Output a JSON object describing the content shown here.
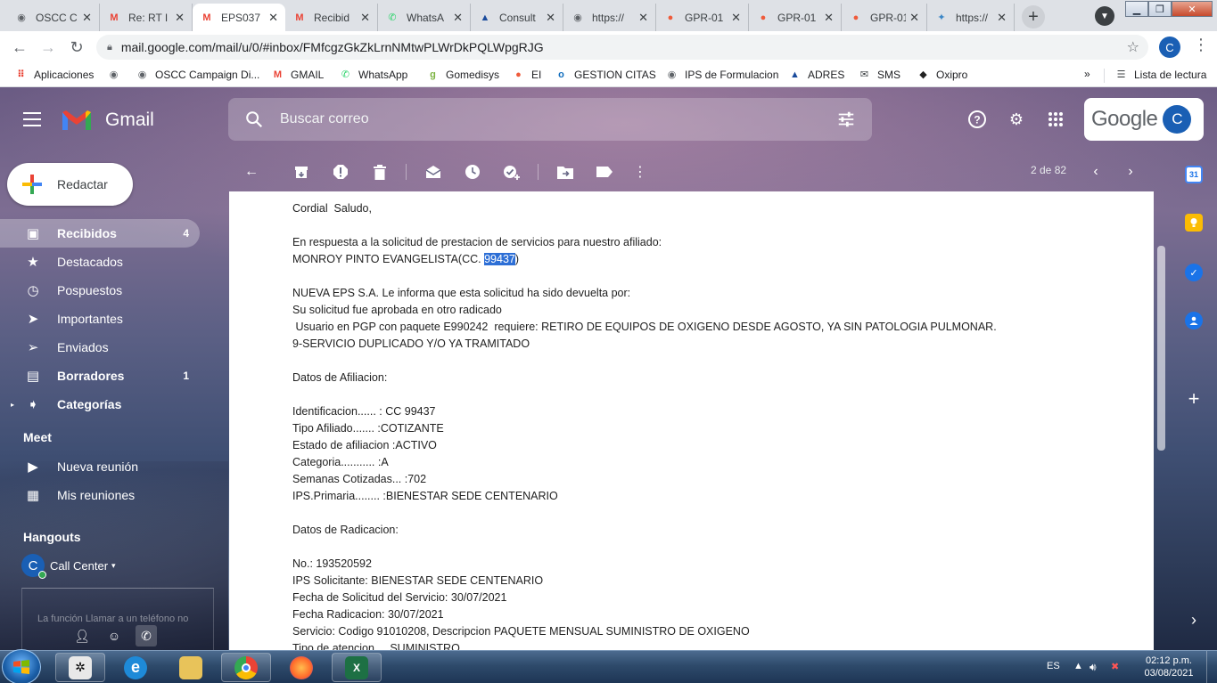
{
  "browser": {
    "tabs": [
      {
        "title": "OSCC C",
        "icon": "globe-icon",
        "color": "#5f6368",
        "active": false
      },
      {
        "title": "Re: RT I",
        "icon": "gmail-icon",
        "color": "#ea4335",
        "active": false
      },
      {
        "title": "EPS037",
        "icon": "gmail-icon",
        "color": "#ea4335",
        "active": true
      },
      {
        "title": "Recibid",
        "icon": "gmail-icon",
        "color": "#ea4335",
        "active": false
      },
      {
        "title": "WhatsA",
        "icon": "whatsapp-icon",
        "color": "#25d366",
        "active": false
      },
      {
        "title": "Consult",
        "icon": "adres-icon",
        "color": "#1a4b9c",
        "active": false
      },
      {
        "title": "https://",
        "icon": "globe-icon",
        "color": "#5f6368",
        "active": false
      },
      {
        "title": "GPR-01",
        "icon": "gpr-icon",
        "color": "#ef5b3b",
        "active": false
      },
      {
        "title": "GPR-01",
        "icon": "gpr-icon",
        "color": "#ef5b3b",
        "active": false
      },
      {
        "title": "GPR-01",
        "icon": "gpr-icon",
        "color": "#ef5b3b",
        "active": false
      },
      {
        "title": "https://",
        "icon": "bird-icon",
        "color": "#3b86c6",
        "active": false
      }
    ],
    "url": "mail.google.com/mail/u/0/#inbox/FMfcgzGkZkLrnNMtwPLWrDkPQLWpgRJG",
    "profile_initial": "C",
    "bookmarks": [
      {
        "label": "Aplicaciones",
        "icon": "apps-grid-icon",
        "color": "#ea4335"
      },
      {
        "label": "",
        "icon": "globe-icon",
        "color": "#5f6368"
      },
      {
        "label": "OSCC Campaign Di...",
        "icon": "globe-icon",
        "color": "#5f6368"
      },
      {
        "label": "GMAIL",
        "icon": "gmail-icon",
        "color": "#ea4335"
      },
      {
        "label": "WhatsApp",
        "icon": "whatsapp-icon",
        "color": "#25d366"
      },
      {
        "label": "Gomedisys",
        "icon": "gomedisys-icon",
        "color": "#7cb342"
      },
      {
        "label": "EI",
        "icon": "gpr-icon",
        "color": "#ef5b3b"
      },
      {
        "label": "GESTION CITAS",
        "icon": "outlook-icon",
        "color": "#0f6cbd"
      },
      {
        "label": "IPS de Formulacion",
        "icon": "globe-icon",
        "color": "#5f6368"
      },
      {
        "label": "ADRES",
        "icon": "adres-icon",
        "color": "#1a4b9c"
      },
      {
        "label": "SMS",
        "icon": "envelope-icon",
        "color": "#3c4043"
      },
      {
        "label": "Oxipro",
        "icon": "oxipro-icon",
        "color": "#222222"
      }
    ],
    "bookmarks_more": "»",
    "reading_list": "Lista de lectura"
  },
  "gmail": {
    "app_name": "Gmail",
    "search_placeholder": "Buscar correo",
    "google_word": "Google",
    "avatar_initial": "C",
    "compose_label": "Redactar",
    "nav": [
      {
        "label": "Recibidos",
        "count": "4",
        "icon": "inbox-icon",
        "active": true,
        "bold": true
      },
      {
        "label": "Destacados",
        "count": "",
        "icon": "star-icon",
        "active": false,
        "bold": false
      },
      {
        "label": "Pospuestos",
        "count": "",
        "icon": "clock-icon",
        "active": false,
        "bold": false
      },
      {
        "label": "Importantes",
        "count": "",
        "icon": "important-icon",
        "active": false,
        "bold": false
      },
      {
        "label": "Enviados",
        "count": "",
        "icon": "send-icon",
        "active": false,
        "bold": false
      },
      {
        "label": "Borradores",
        "count": "1",
        "icon": "draft-icon",
        "active": false,
        "bold": true
      },
      {
        "label": "Categorías",
        "count": "",
        "icon": "label-icon",
        "active": false,
        "bold": true
      }
    ],
    "meet": {
      "title": "Meet",
      "items": [
        {
          "label": "Nueva reunión",
          "icon": "video-camera-icon"
        },
        {
          "label": "Mis reuniones",
          "icon": "calendar-icon"
        }
      ]
    },
    "hangouts": {
      "title": "Hangouts",
      "user_initial": "C",
      "user_name": "Call Center",
      "note": "La función Llamar a un teléfono no"
    },
    "page_info": "2 de 82",
    "email_lines": [
      "Cordial  Saludo,",
      "",
      "En respuesta a la solicitud de prestacion de servicios para nuestro afiliado:",
      "__AFILIADO__",
      "",
      "NUEVA EPS S.A. Le informa que esta solicitud ha sido devuelta por:",
      "Su solicitud fue aprobada en otro radicado",
      " Usuario en PGP con paquete E990242  requiere: RETIRO DE EQUIPOS DE OXIGENO DESDE AGOSTO, YA SIN PATOLOGIA PULMONAR.",
      "9-SERVICIO DUPLICADO Y/O YA TRAMITADO",
      "",
      "Datos de Afiliacion:",
      "",
      "Identificacion...... : CC 99437",
      "Tipo Afiliado....... :COTIZANTE",
      "Estado de afiliacion :ACTIVO",
      "Categoria........... :A",
      "Semanas Cotizadas... :702",
      "IPS.Primaria........ :BIENESTAR SEDE CENTENARIO",
      "",
      "Datos de Radicacion:",
      "",
      "No.: 193520592",
      "IPS Solicitante: BIENESTAR SEDE CENTENARIO",
      "Fecha de Solicitud del Servicio: 30/07/2021",
      "Fecha Radicacion: 30/07/2021",
      "Servicio: Codigo 91010208, Descripcion PAQUETE MENSUAL SUMINISTRO DE OXIGENO",
      "Tipo de atencion.... SUMINISTRO"
    ],
    "afiliado_prefix": "MONROY PINTO EVANGELISTA(CC. ",
    "afiliado_selected": "99437",
    "afiliado_suffix": ")"
  },
  "taskbar": {
    "language": "ES",
    "time": "02:12 p.m.",
    "date": "03/08/2021"
  }
}
